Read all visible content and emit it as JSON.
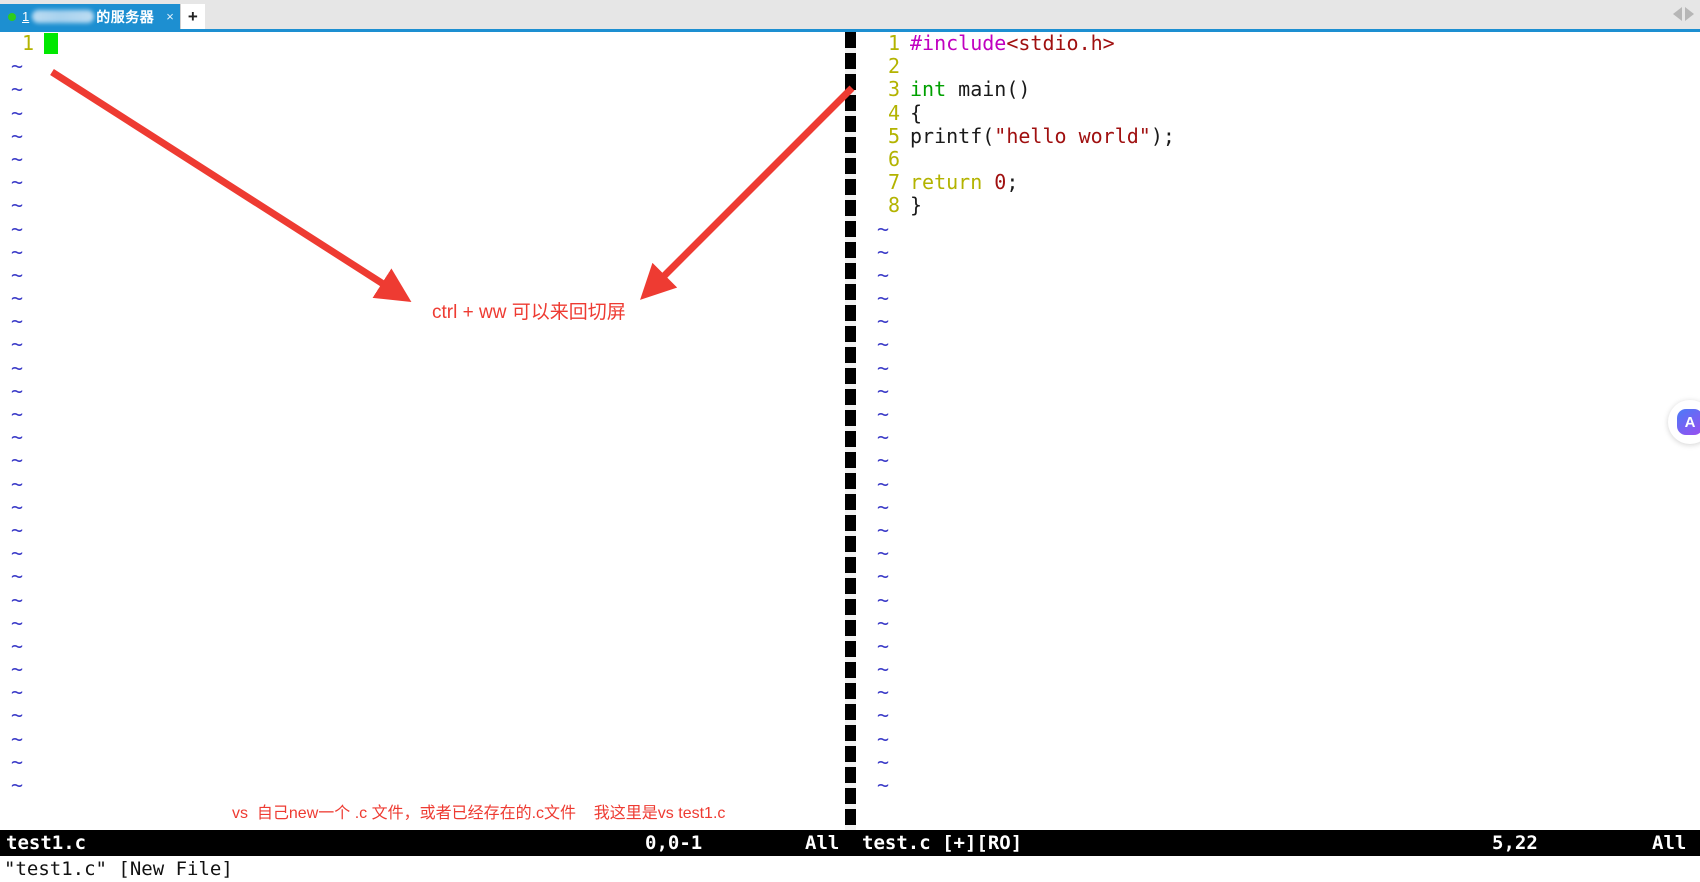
{
  "tabbar": {
    "tab": {
      "index": "1",
      "title": "的服务器",
      "close_label": "×",
      "dot_color": "#2ecc1e",
      "bg_color": "#1d8fd1"
    },
    "new_tab_label": "+",
    "nav_left_icon": "chevron-left-icon",
    "nav_right_icon": "chevron-right-icon"
  },
  "editor": {
    "left_pane": {
      "line_number": "1",
      "tilde": "~",
      "tilde_count": 32,
      "cursor": "block"
    },
    "right_pane": {
      "tilde": "~",
      "tilde_count": 25,
      "lines": [
        {
          "num": "1",
          "tokens": [
            {
              "t": "#include",
              "c": "pre"
            },
            {
              "t": "<stdio.h>",
              "c": "inc"
            }
          ]
        },
        {
          "num": "2",
          "tokens": []
        },
        {
          "num": "3",
          "tokens": [
            {
              "t": "int ",
              "c": "type"
            },
            {
              "t": "main()",
              "c": "plain"
            }
          ]
        },
        {
          "num": "4",
          "tokens": [
            {
              "t": "{",
              "c": "plain"
            }
          ]
        },
        {
          "num": "5",
          "tokens": [
            {
              "t": "printf(",
              "c": "plain"
            },
            {
              "t": "\"hello world\"",
              "c": "str"
            },
            {
              "t": ");",
              "c": "plain"
            }
          ]
        },
        {
          "num": "6",
          "tokens": []
        },
        {
          "num": "7",
          "tokens": [
            {
              "t": "return ",
              "c": "kw"
            },
            {
              "t": "0",
              "c": "num"
            },
            {
              "t": ";",
              "c": "plain"
            }
          ]
        },
        {
          "num": "8",
          "tokens": [
            {
              "t": "}",
              "c": "plain"
            }
          ]
        }
      ]
    }
  },
  "status": {
    "left": {
      "filename": "test1.c",
      "position": "0,0-1",
      "percent": "All"
    },
    "right": {
      "filename": "test.c [+][RO]",
      "position": "5,22",
      "percent": "All"
    }
  },
  "message_line": "\"test1.c\" [New File]",
  "annotations": {
    "switch_hint": "ctrl + ww 可以来回切屏",
    "bottom_hint": "vs  自己new一个 .c 文件，或者已经存在的.c文件    我这里是vs test1.c",
    "color": "#ee3b32"
  },
  "float_widget": {
    "icon": "assistant-avatar-icon",
    "glyph": "A"
  }
}
